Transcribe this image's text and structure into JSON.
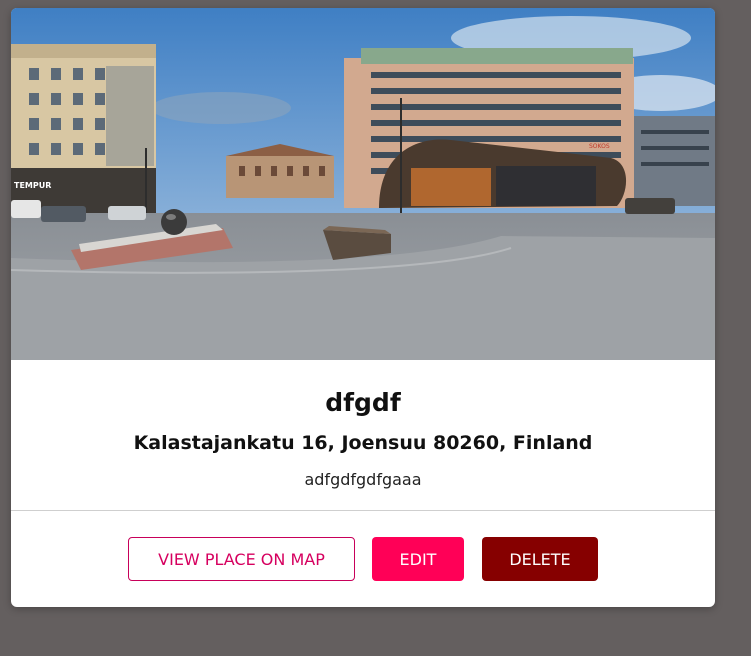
{
  "place": {
    "title": "dfgdf",
    "address": "Kalastajankatu 16, Joensuu 80260, Finland",
    "description": "adfgdfgdfgaaa",
    "image_alt": "town square"
  },
  "actions": {
    "view_on_map": "VIEW PLACE ON MAP",
    "edit": "EDIT",
    "delete": "DELETE"
  },
  "colors": {
    "page_background": "#645f5f",
    "card_background": "#ffffff",
    "map_button_border": "#c8005a",
    "edit_button": "#ff0057",
    "delete_button": "#860000"
  },
  "shop_signs": {
    "left": "TEMPUR",
    "right": "SOKOS"
  }
}
